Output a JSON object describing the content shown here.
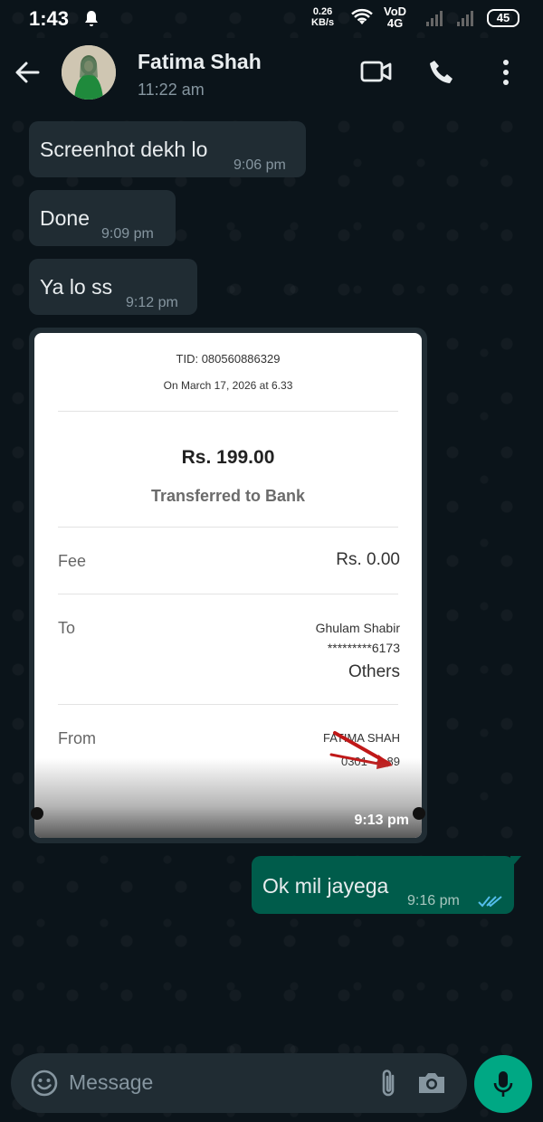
{
  "status_bar": {
    "time": "1:43",
    "net_speed_value": "0.26",
    "net_speed_unit": "KB/s",
    "carrier_top": "VoD",
    "carrier_bottom": "4G",
    "battery": "45"
  },
  "header": {
    "contact_name": "Fatima Shah",
    "last_seen": "11:22 am"
  },
  "messages": [
    {
      "text": "Screenhot dekh lo",
      "time": "9:06 pm"
    },
    {
      "text": "Done",
      "time": "9:09 pm"
    },
    {
      "text": "Ya lo ss",
      "time": "9:12 pm"
    }
  ],
  "receipt": {
    "tid": "TID: 080560886329",
    "date": "On March 17, 2026 at 6.33",
    "amount": "Rs. 199.00",
    "status": "Transferred to Bank",
    "fee_label": "Fee",
    "fee_value": "Rs. 0.00",
    "to_label": "To",
    "to_name": "Ghulam Shabir",
    "to_account": "*********6173",
    "to_bank": "Others",
    "from_label": "From",
    "from_name": "FATIMA SHAH",
    "from_account": "0301·····89",
    "time": "9:13 pm"
  },
  "outgoing": {
    "text": "Ok mil jayega",
    "time": "9:16 pm"
  },
  "input": {
    "placeholder": "Message"
  },
  "colors": {
    "background": "#0b141a",
    "incoming_bubble": "#202c33",
    "outgoing_bubble": "#005c4b",
    "accent": "#00a884",
    "read_ticks": "#53bdeb"
  }
}
